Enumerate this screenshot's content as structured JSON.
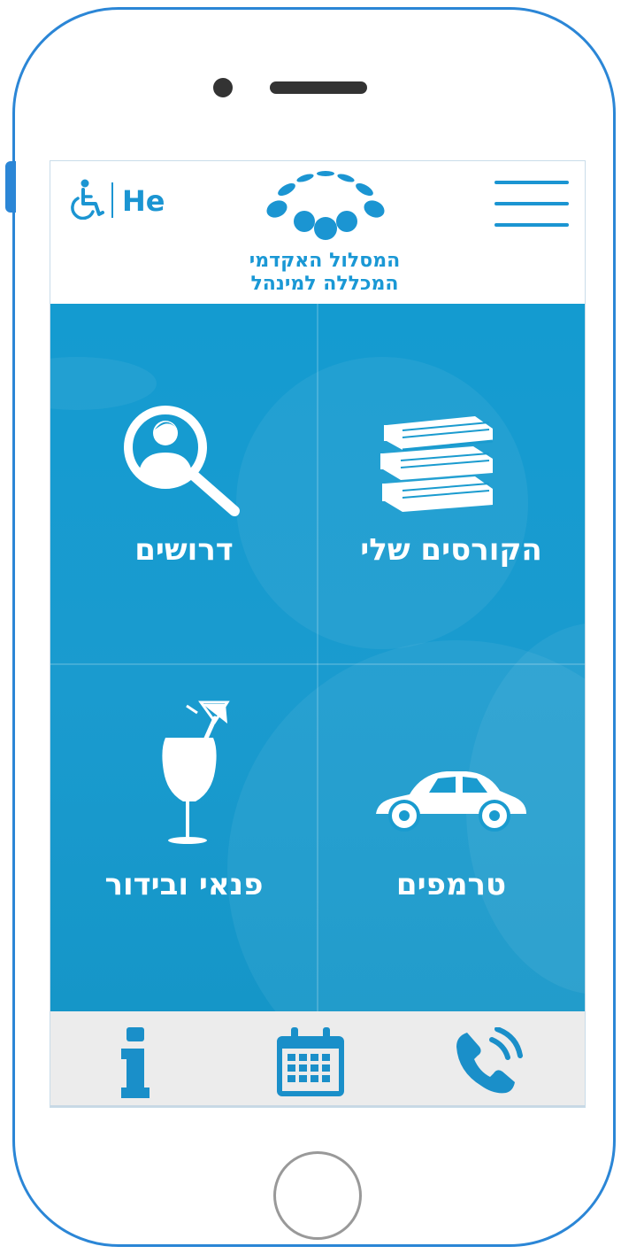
{
  "header": {
    "accessibility_icon": "wheelchair-icon",
    "language_label": "He",
    "menu_icon": "hamburger-menu-icon",
    "logo_icon": "dots-arc-logo",
    "school_name_line1": "המסלול האקדמי",
    "school_name_line2": "המכללה למינהל"
  },
  "tiles": [
    {
      "label": "הקורסים שלי",
      "icon": "books-icon"
    },
    {
      "label": "דרושים",
      "icon": "person-search-icon"
    },
    {
      "label": "טרמפים",
      "icon": "car-icon"
    },
    {
      "label": "פנאי ובידור",
      "icon": "cocktail-icon"
    }
  ],
  "bottom_nav": [
    {
      "icon": "phone-icon"
    },
    {
      "icon": "calendar-icon"
    },
    {
      "icon": "info-icon"
    }
  ],
  "colors": {
    "accent": "#1b95d2",
    "tile_bg": "#1a9bcf",
    "bottom_bg": "#ececec",
    "frame": "#2b86d6"
  }
}
